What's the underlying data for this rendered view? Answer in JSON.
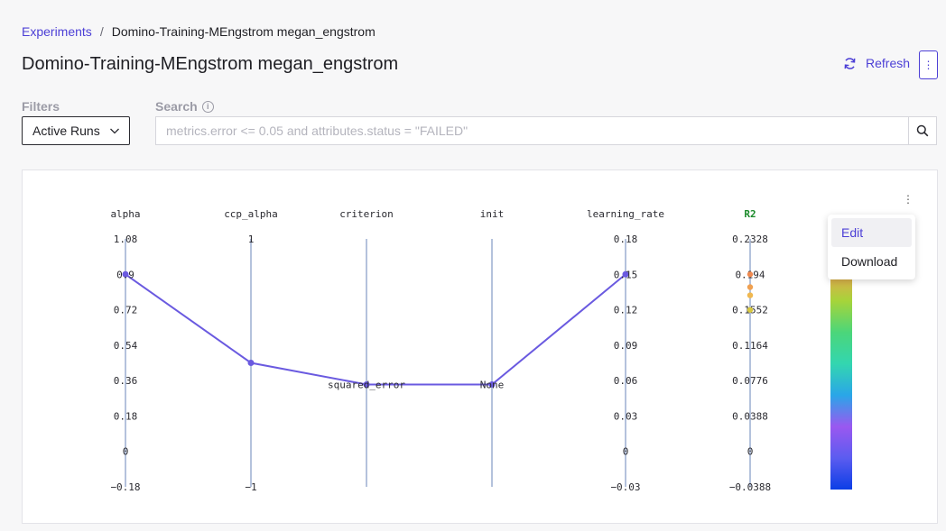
{
  "breadcrumb": {
    "link_label": "Experiments",
    "separator": "/",
    "current": "Domino-Training-MEngstrom megan_engstrom"
  },
  "page_title": "Domino-Training-MEngstrom megan_engstrom",
  "header_actions": {
    "refresh_label": "Refresh",
    "refresh_icon": "refresh-icon",
    "more_icon": "more-vertical-icon"
  },
  "filters": {
    "label": "Filters",
    "selected": "Active Runs"
  },
  "search": {
    "label": "Search",
    "placeholder": "metrics.error <= 0.05 and attributes.status = \"FAILED\"",
    "value": ""
  },
  "colors": {
    "accent": "#4c3fd6",
    "line": "#6a5ae0",
    "axis": "#b4c2dc"
  },
  "chart_data": {
    "type": "parallel_coordinates",
    "axes": [
      {
        "name": "alpha",
        "ticks": [
          "1.08",
          "0.9",
          "0.72",
          "0.54",
          "0.36",
          "0.18",
          "0",
          "−0.18"
        ],
        "range": [
          -0.18,
          1.08
        ]
      },
      {
        "name": "ccp_alpha",
        "ticks": [
          "1",
          "−1"
        ],
        "range": [
          -1,
          1
        ]
      },
      {
        "name": "criterion",
        "ticks": [
          "squared_error"
        ],
        "categorical": true
      },
      {
        "name": "init",
        "ticks": [
          "None"
        ],
        "categorical": true
      },
      {
        "name": "learning_rate",
        "ticks": [
          "0.18",
          "0.15",
          "0.12",
          "0.09",
          "0.06",
          "0.03",
          "0",
          "−0.03"
        ],
        "range": [
          -0.03,
          0.18
        ]
      },
      {
        "name": "R2",
        "ticks": [
          "0.2328",
          "0.194",
          "0.1552",
          "0.1164",
          "0.0776",
          "0.0388",
          "0",
          "−0.0388"
        ],
        "range": [
          -0.0388,
          0.2328
        ],
        "highlight": true
      }
    ],
    "line": {
      "alpha": 0.9,
      "ccp_alpha": 0,
      "criterion": "squared_error",
      "init": "None",
      "learning_rate": 0.15
    },
    "r2_points": [
      0.194,
      0.18,
      0.171,
      0.155
    ],
    "colorscale": [
      "#0b3ee6",
      "#5b5cf0",
      "#9a58f0",
      "#2aa6e8",
      "#33d6b0",
      "#4bd67a",
      "#a6d43a",
      "#f0a050"
    ]
  },
  "plot_menu": {
    "dots_icon": "more-vertical-icon",
    "items": [
      {
        "label": "Edit"
      },
      {
        "label": "Download"
      }
    ]
  }
}
